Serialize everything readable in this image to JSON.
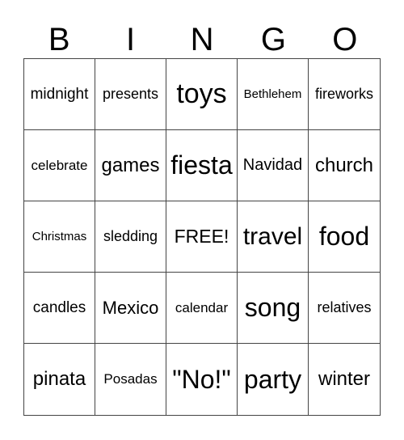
{
  "header": [
    "B",
    "I",
    "N",
    "G",
    "O"
  ],
  "cells": [
    "midnight",
    "presents",
    "toys",
    "Bethlehem",
    "fireworks",
    "celebrate",
    "games",
    "fiesta",
    "Navidad",
    "church",
    "Christmas",
    "sledding",
    "FREE!",
    "travel",
    "food",
    "candles",
    "Mexico",
    "calendar",
    "song",
    "relatives",
    "pinata",
    "Posadas",
    "\"No!\"",
    "party",
    "winter"
  ]
}
